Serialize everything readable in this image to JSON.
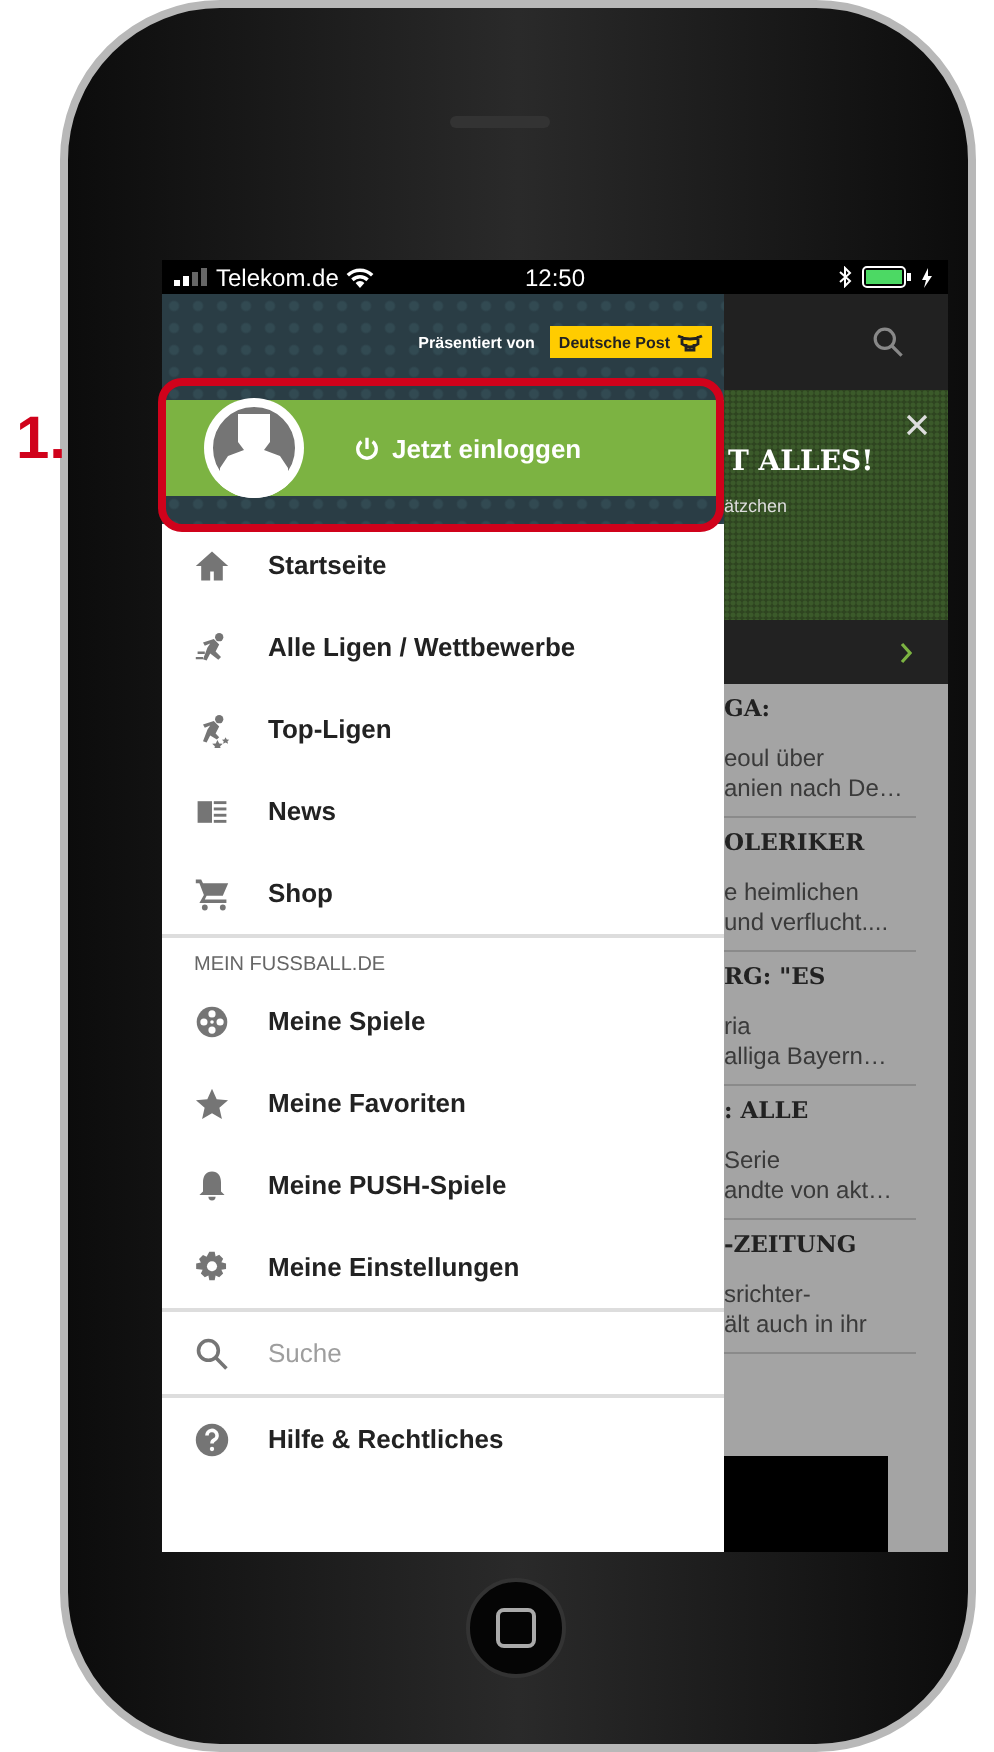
{
  "annotation": {
    "number": "1."
  },
  "status_bar": {
    "carrier": "Telekom.de",
    "time": "12:50"
  },
  "drawer": {
    "sponsor_label": "Präsentiert von",
    "sponsor_logo": "Deutsche Post",
    "login_button": "Jetzt einloggen",
    "main_items": [
      {
        "label": "Startseite",
        "kind": "home"
      },
      {
        "label": "Alle Ligen / Wettbewerbe",
        "kind": "player"
      },
      {
        "label": "Top-Ligen",
        "kind": "stars"
      },
      {
        "label": "News",
        "kind": "news"
      },
      {
        "label": "Shop",
        "kind": "cart"
      }
    ],
    "section_title": "MEIN FUSSBALL.DE",
    "my_items": [
      {
        "label": "Meine Spiele",
        "kind": "reel"
      },
      {
        "label": "Meine Favoriten",
        "kind": "star"
      },
      {
        "label": "Meine PUSH-Spiele",
        "kind": "bell"
      },
      {
        "label": "Meine Einstellungen",
        "kind": "gear"
      }
    ],
    "search": {
      "placeholder": "Suche"
    },
    "help_item": {
      "label": "Hilfe & Rechtliches",
      "kind": "help"
    }
  },
  "background": {
    "banner": {
      "headline": "T ALLES!",
      "subline": "ätzchen"
    },
    "articles": [
      {
        "headline": "GA:",
        "lines": [
          "eoul über",
          "anien nach De…"
        ]
      },
      {
        "headline": "OLERIKER",
        "lines": [
          "e heimlichen",
          "und verflucht...."
        ]
      },
      {
        "headline": "RG: \"ES",
        "lines": [
          "ria",
          "alliga Bayern…"
        ]
      },
      {
        "headline": ": ALLE",
        "lines": [
          "Serie",
          "andte von akt…"
        ]
      },
      {
        "headline": "-ZEITUNG",
        "lines": [
          "srichter-",
          "ält auch in ihr"
        ]
      }
    ]
  }
}
